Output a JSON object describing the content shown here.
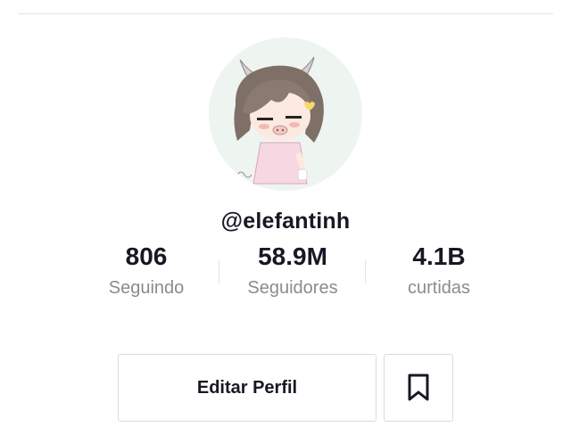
{
  "profile": {
    "username": "@elefantinh",
    "avatar_icon": "gacha-character-avatar"
  },
  "stats": [
    {
      "value": "806",
      "label": "Seguindo"
    },
    {
      "value": "58.9M",
      "label": "Seguidores"
    },
    {
      "value": "4.1B",
      "label": "curtidas"
    }
  ],
  "actions": {
    "edit_label": "Editar Perfil",
    "bookmark_icon": "bookmark-icon"
  },
  "colors": {
    "text_primary": "#161823",
    "text_secondary": "#8a8b91",
    "border": "#dcdcdf"
  }
}
